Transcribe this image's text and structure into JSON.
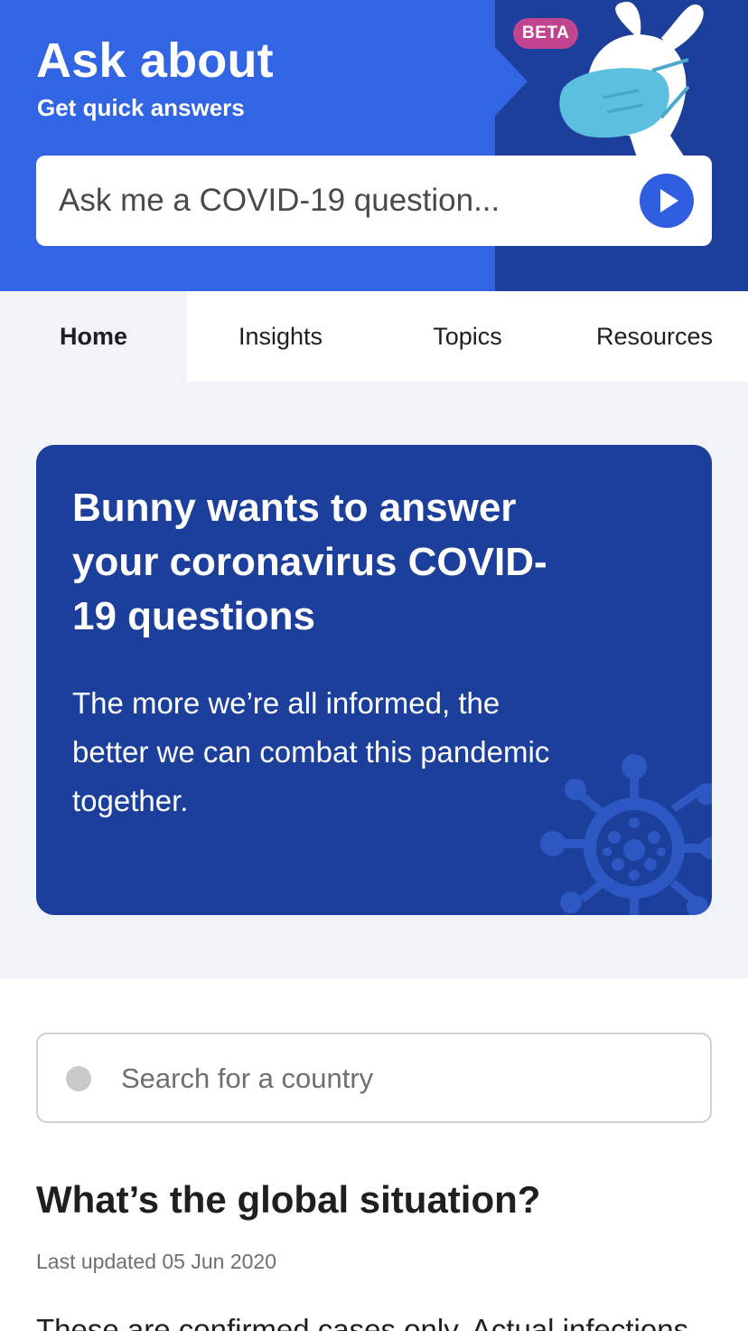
{
  "header": {
    "title": "Ask about",
    "subtitle": "Get quick answers",
    "badge": "BETA",
    "search_placeholder": "Ask me a COVID-19 question...",
    "colors": {
      "primary": "#3265e3",
      "dark": "#1b3f9a",
      "badge": "#c0448f",
      "mask": "#5bbfe0"
    }
  },
  "tabs": [
    {
      "label": "Home",
      "active": true
    },
    {
      "label": "Insights",
      "active": false
    },
    {
      "label": "Topics",
      "active": false
    },
    {
      "label": "Resources",
      "active": false
    }
  ],
  "hero": {
    "heading": "Bunny wants to answer your coronavirus COVID-19 questions",
    "body": "The more we’re all informed, the better we can combat this pandemic together."
  },
  "country_search": {
    "placeholder": "Search for a country",
    "icon": "search-icon"
  },
  "global": {
    "title": "What’s the global situation?",
    "updated": "Last updated 05 Jun 2020",
    "intro": "These are confirmed cases only. Actual infections"
  }
}
